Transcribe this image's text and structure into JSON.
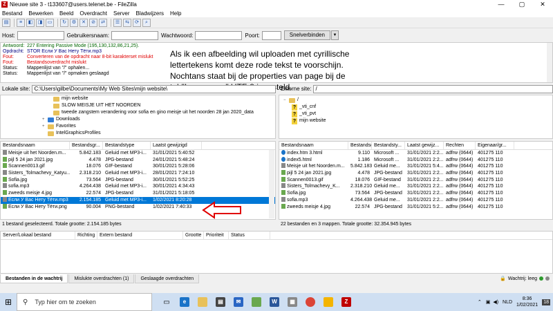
{
  "window": {
    "title": "Nieuwe site 3 - t133607@users.telenet.be - FileZilla",
    "app_letter": "Z",
    "controls": [
      "—",
      "▢",
      "✕"
    ]
  },
  "menu": [
    "Bestand",
    "Bewerken",
    "Beeld",
    "Overdracht",
    "Server",
    "Bladwijzers",
    "Help"
  ],
  "quickconnect": {
    "host_label": "Host:",
    "user_label": "Gebruikersnaam:",
    "pass_label": "Wachtwoord:",
    "port_label": "Poort:",
    "connect_label": "Snelverbinden",
    "dropdown_glyph": "▼"
  },
  "log": [
    {
      "label": "Antwoord:",
      "text": "227 Entering Passive Mode (195,130,132,86,21,25).",
      "type": "green"
    },
    {
      "label": "Opdracht:",
      "text": "STOR Если У Вас Нету Тёти.mp3",
      "type": "blue"
    },
    {
      "label": "Fout:",
      "text": "Converteren van de opdracht naar 8-bit karakterset mislukt",
      "type": "red"
    },
    {
      "label": "Fout:",
      "text": "Bestandsoverdracht mislukt",
      "type": "red"
    },
    {
      "label": "Status:",
      "text": "Mappenlijst van \"/\" ophalen...",
      "type": "black"
    },
    {
      "label": "Status:",
      "text": "Mappenlijst van \"/\" opmaken geslaagd",
      "type": "black"
    }
  ],
  "overlay_note": "Als ik een afbeelding wil uploaden met cyrillische lettertekens  komt deze rode tekst te voorschijn. Nochtans staat bij de properties van page bij de tab\"Languages\" UTF-8 ingesteld.",
  "local": {
    "site_label": "Lokale site:",
    "site_path": "C:\\Users\\gilbe\\Documents\\My Web Sites\\mijn website\\",
    "tree": [
      {
        "name": "mijn website",
        "indent": 4,
        "icon": "folder"
      },
      {
        "name": "SLOW MEISJE UIT HET NOORDEN",
        "indent": 4,
        "icon": "folder"
      },
      {
        "name": "tweede zangstem verandering voor sofia en gino meisje uit het noorden 28 jan 2020_data",
        "indent": 4,
        "icon": "folder"
      },
      {
        "name": "Downloads",
        "indent": 1,
        "icon": "blue",
        "exp": "+"
      },
      {
        "name": "Favorites",
        "indent": 1,
        "icon": "star",
        "exp": "+"
      },
      {
        "name": "IntelGraphicsProfiles",
        "indent": 1,
        "icon": "folder"
      }
    ],
    "columns": [
      "Bestandsnaam",
      "Bestandsgr...",
      "Bestandstype",
      "Laatst gewijzigd"
    ],
    "rows": [
      {
        "name": "Meisje uit het Noorden.m...",
        "size": "5.842.183",
        "type": "Geluid met MP3-i...",
        "date": "31/01/2021 5:40:52",
        "icon": "audio"
      },
      {
        "name": "pijl 5 24 jan 2021.jpg",
        "size": "4.478",
        "type": "JPG-bestand",
        "date": "24/01/2021 5:48:24",
        "icon": "img"
      },
      {
        "name": "Scannen0013.gif",
        "size": "18.076",
        "type": "GIF-bestand",
        "date": "30/01/2021 5:28:06",
        "icon": "img"
      },
      {
        "name": "Sisters_Tolmachevy_Katyu...",
        "size": "2.318.210",
        "type": "Geluid met MP3-i...",
        "date": "28/01/2021 7:24:10",
        "icon": "audio"
      },
      {
        "name": "Sofia.jpg",
        "size": "73.564",
        "type": "JPG-bestand",
        "date": "30/01/2021 5:52:25",
        "icon": "img"
      },
      {
        "name": "sofia.mp3",
        "size": "4.264.438",
        "type": "Geluid met MP3-i...",
        "date": "30/01/2021 4:34:43",
        "icon": "audio"
      },
      {
        "name": "zweeds meisje 4.jpg",
        "size": "22.574",
        "type": "JPG-bestand",
        "date": "31/01/2021 5:18:05",
        "icon": "img"
      },
      {
        "name": "Если У Вас Нету Тёти.mp3",
        "size": "2.154.185",
        "type": "Geluid met MP3-i...",
        "date": "1/02/2021 8:20:28",
        "icon": "audio",
        "selected": true
      },
      {
        "name": "Если У Вас Нету Тёти.png",
        "size": "90.004",
        "type": "PNG-bestand",
        "date": "1/02/2021 7:40:33",
        "icon": "img"
      }
    ],
    "status": "1 bestand geselecteerd. Totale grootte: 2.154.185 bytes"
  },
  "remote": {
    "site_label": "Externe site:",
    "site_path": "/",
    "tree": [
      {
        "name": "/",
        "indent": 1,
        "icon": "folder",
        "exp": "−"
      },
      {
        "name": "_vti_cnf",
        "indent": 2,
        "icon": "qm"
      },
      {
        "name": "_vti_pvt",
        "indent": 2,
        "icon": "qm"
      },
      {
        "name": "mijn website",
        "indent": 2,
        "icon": "qm"
      }
    ],
    "columns": [
      "Bestandsnaam",
      "Bestandsgr...",
      "Bestandsty...",
      "Laatst gewijz...",
      "Rechten",
      "Eigenaar/gr..."
    ],
    "rows": [
      {
        "name": "index.htm 3.html",
        "size": "9.110",
        "type": "Microsoft ...",
        "date": "31/01/2021 2:2...",
        "perm": "adfrw (0644)",
        "owner": "401275 110",
        "icon": "edge"
      },
      {
        "name": "index5.html",
        "size": "1.186",
        "type": "Microsoft ...",
        "date": "31/01/2021 2:2...",
        "perm": "adfrw (0644)",
        "owner": "401275 110",
        "icon": "edge"
      },
      {
        "name": "Meisje uit het Noorden.m...",
        "size": "5.842.183",
        "type": "Geluid me...",
        "date": "31/01/2021 5:4...",
        "perm": "adfrw (0644)",
        "owner": "401275 110",
        "icon": "audio"
      },
      {
        "name": "pijl 5 24 jan 2021.jpg",
        "size": "4.478",
        "type": "JPG-bestand",
        "date": "31/01/2021 2:2...",
        "perm": "adfrw (0644)",
        "owner": "401275 110",
        "icon": "img"
      },
      {
        "name": "Scannen0013.gif",
        "size": "18.076",
        "type": "GIF-bestand",
        "date": "31/01/2021 2:2...",
        "perm": "adfrw (0644)",
        "owner": "401275 110",
        "icon": "img"
      },
      {
        "name": "Sisters_Tolmachevy_K...",
        "size": "2.318.210",
        "type": "Geluid me...",
        "date": "31/01/2021 2:2...",
        "perm": "adfrw (0644)",
        "owner": "401275 110",
        "icon": "audio"
      },
      {
        "name": "Sofia.jpg",
        "size": "73.564",
        "type": "JPG-bestand",
        "date": "31/01/2021 2:2...",
        "perm": "adfrw (0644)",
        "owner": "401275 110",
        "icon": "img"
      },
      {
        "name": "sofia.mp3",
        "size": "4.264.438",
        "type": "Geluid me...",
        "date": "31/01/2021 2:2...",
        "perm": "adfrw (0644)",
        "owner": "401275 110",
        "icon": "audio"
      },
      {
        "name": "zweeds meisje 4.jpg",
        "size": "22.574",
        "type": "JPG-bestand",
        "date": "31/01/2021 5:2...",
        "perm": "adfrw (0644)",
        "owner": "401275 110",
        "icon": "img"
      }
    ],
    "status": "22 bestanden en 3 mappen. Totale grootte: 32.354.945 bytes"
  },
  "queue": {
    "columns": [
      "Server/Lokaal bestand",
      "Richting",
      "Extern bestand",
      "Grootte",
      "Prioriteit",
      "Status"
    ],
    "tabs": [
      "Bestanden in de wachtrij",
      "Mislukte overdrachten (1)",
      "Geslaagde overdrachten"
    ],
    "status_text": "Wachtrij: leeg"
  },
  "taskbar": {
    "search_placeholder": "Typ hier om te zoeken",
    "time": "8:36",
    "date": "1/02/2021",
    "lang": "NLD",
    "notif_count": "18"
  },
  "colors": {
    "selection": "#0078d7",
    "error": "#e00000",
    "arrow": "#e00000"
  }
}
